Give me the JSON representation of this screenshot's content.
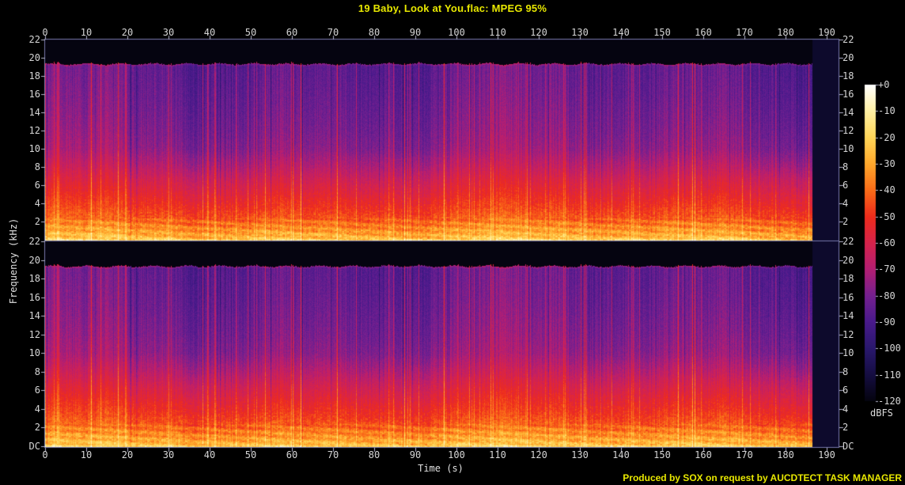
{
  "title": "19 Baby, Look at You.flac: MPEG 95%",
  "footer_credit": "Produced by SOX on request by AUCDTECT TASK MANAGER",
  "axis": {
    "time_label": "Time (s)",
    "freq_label": "Frequency (kHz)",
    "time_ticks": [
      "0",
      "10",
      "20",
      "30",
      "40",
      "50",
      "60",
      "70",
      "80",
      "90",
      "100",
      "110",
      "120",
      "130",
      "140",
      "150",
      "160",
      "170",
      "180",
      "190"
    ],
    "freq_ticks": [
      "22",
      "20",
      "18",
      "16",
      "14",
      "12",
      "10",
      "8",
      "6",
      "4",
      "2"
    ],
    "dc_tick": "DC"
  },
  "colorbar": {
    "unit": "dBFS",
    "ticks": [
      "+0",
      "-10",
      "-20",
      "-30",
      "-40",
      "-50",
      "-60",
      "-70",
      "-80",
      "-90",
      "-100",
      "-110",
      "-120"
    ]
  },
  "colors": {
    "background": "#000000",
    "title_text": "#e8e800",
    "credit_text": "#e8e800",
    "axis_text": "#d6d6d6",
    "axis_line": "#7a7aae",
    "tick_mark": "#b4b4cc",
    "no_data_fill": "#0d0a2c"
  },
  "chart_data": {
    "type": "heatmap",
    "variant": "stereo-audio-spectrogram",
    "title": "19 Baby, Look at You.flac: MPEG 95%",
    "xlabel": "Time (s)",
    "ylabel": "Frequency (kHz)",
    "channels": [
      "left",
      "right"
    ],
    "x_range_s": [
      0,
      193
    ],
    "x_tick_step_s": 10,
    "y_range_khz": [
      0,
      22
    ],
    "y_tick_step_khz": 2,
    "z_unit": "dBFS",
    "z_range_dbfs": [
      -120,
      0
    ],
    "audio_duration_s": 186.5,
    "lowpass_cutoff_khz": 19.4,
    "palette_dbfs": [
      {
        "db": -120,
        "color": "#050410"
      },
      {
        "db": -110,
        "color": "#160e43"
      },
      {
        "db": -100,
        "color": "#2a186e"
      },
      {
        "db": -90,
        "color": "#4a1a8c"
      },
      {
        "db": -80,
        "color": "#762090"
      },
      {
        "db": -70,
        "color": "#b41e73"
      },
      {
        "db": -60,
        "color": "#d7234b"
      },
      {
        "db": -50,
        "color": "#ee2c1c"
      },
      {
        "db": -40,
        "color": "#fa6c18"
      },
      {
        "db": -30,
        "color": "#ffa82c"
      },
      {
        "db": -20,
        "color": "#ffd658"
      },
      {
        "db": -10,
        "color": "#fff0a4"
      },
      {
        "db": 0,
        "color": "#ffffff"
      }
    ],
    "energy_profile_dbfs_by_khz": [
      [
        0,
        -21
      ],
      [
        0.4,
        -26
      ],
      [
        1,
        -31
      ],
      [
        1.8,
        -37
      ],
      [
        2.6,
        -43
      ],
      [
        3.5,
        -47
      ],
      [
        5,
        -53
      ],
      [
        6.5,
        -59
      ],
      [
        8,
        -66
      ],
      [
        10,
        -74
      ],
      [
        12,
        -77
      ],
      [
        15,
        -80
      ],
      [
        17.5,
        -82
      ],
      [
        19.4,
        -83
      ]
    ],
    "texture": {
      "column_db_swing": 9,
      "transient_probability": 0.085,
      "transient_boost_db": [
        8,
        23
      ],
      "cutoff_fringe_boost_db": 13,
      "low_freq_blotch_db": 11
    },
    "no_data_region_from_s": 186.5,
    "legend_position": "right-colorbar",
    "grid": false
  }
}
